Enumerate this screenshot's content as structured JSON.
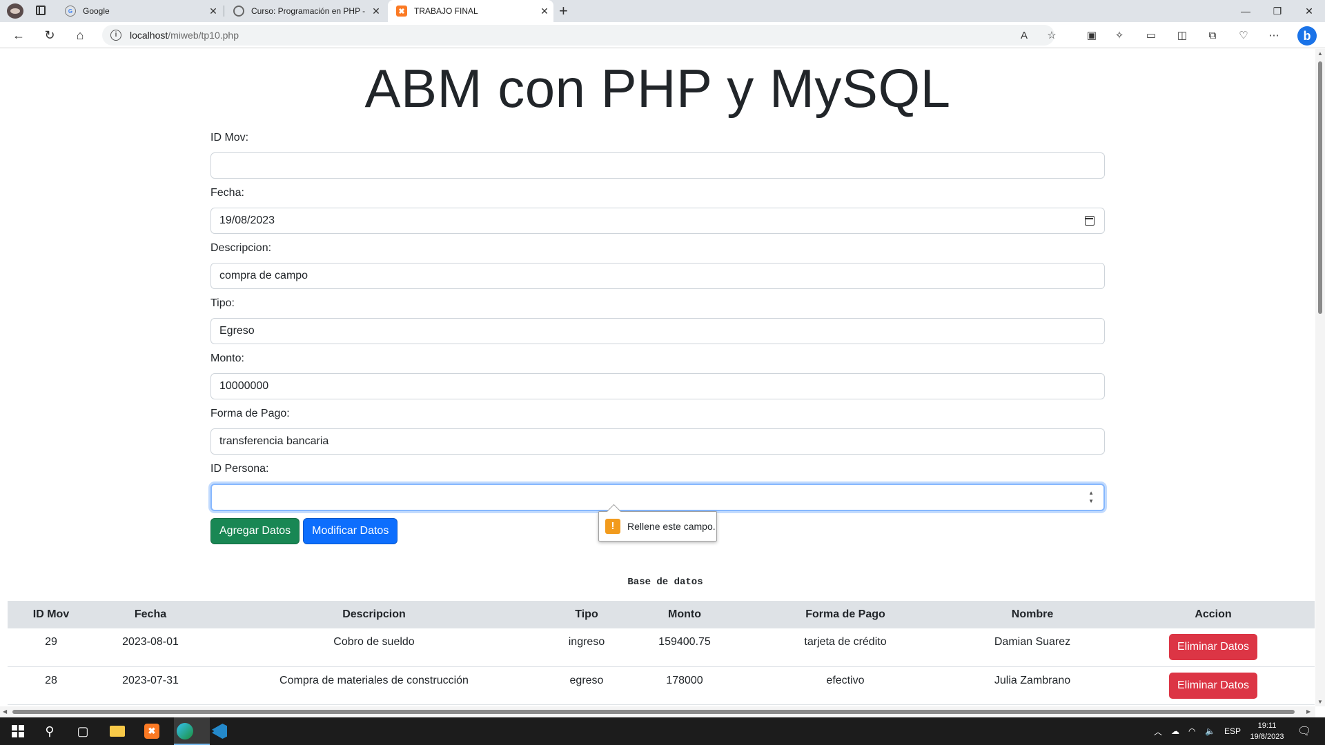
{
  "browser": {
    "tabs": [
      {
        "title": "Google",
        "icon": "google-icon"
      },
      {
        "title": "Curso: Programación en PHP - N",
        "icon": "curso-icon"
      },
      {
        "title": "TRABAJO FINAL",
        "icon": "xampp-icon"
      }
    ],
    "url_host": "localhost",
    "url_path": "/miweb/tp10.php"
  },
  "page": {
    "title": "ABM con PHP y MySQL",
    "fields": [
      {
        "label": "ID Mov:",
        "value": ""
      },
      {
        "label": "Fecha:",
        "value": "19/08/2023"
      },
      {
        "label": "Descripcion:",
        "value": "compra de campo"
      },
      {
        "label": "Tipo:",
        "value": "Egreso"
      },
      {
        "label": "Monto:",
        "value": "10000000"
      },
      {
        "label": "Forma de Pago:",
        "value": "transferencia bancaria"
      },
      {
        "label": "ID Persona:",
        "value": ""
      }
    ],
    "buttons": {
      "add": "Agregar Datos",
      "modify": "Modificar Datos"
    },
    "tooltip": "Rellene este campo.",
    "db_title": "Base de datos",
    "table": {
      "headers": [
        "ID Mov",
        "Fecha",
        "Descripcion",
        "Tipo",
        "Monto",
        "Forma de Pago",
        "Nombre",
        "Accion"
      ],
      "rows": [
        {
          "id": "29",
          "fecha": "2023-08-01",
          "descripcion": "Cobro de sueldo",
          "tipo": "ingreso",
          "monto": "159400.75",
          "forma": "tarjeta de crédito",
          "nombre": "Damian Suarez",
          "accion": "Eliminar Datos"
        },
        {
          "id": "28",
          "fecha": "2023-07-31",
          "descripcion": "Compra de materiales de construcción",
          "tipo": "egreso",
          "monto": "178000",
          "forma": "efectivo",
          "nombre": "Julia Zambrano",
          "accion": "Eliminar Datos"
        }
      ]
    }
  },
  "taskbar": {
    "lang": "ESP",
    "time": "19:11",
    "date": "19/8/2023"
  },
  "colors": {
    "btn_green": "#198754",
    "btn_blue": "#0d6efd",
    "btn_red": "#dc3545",
    "focus_border": "#86b7fe"
  }
}
